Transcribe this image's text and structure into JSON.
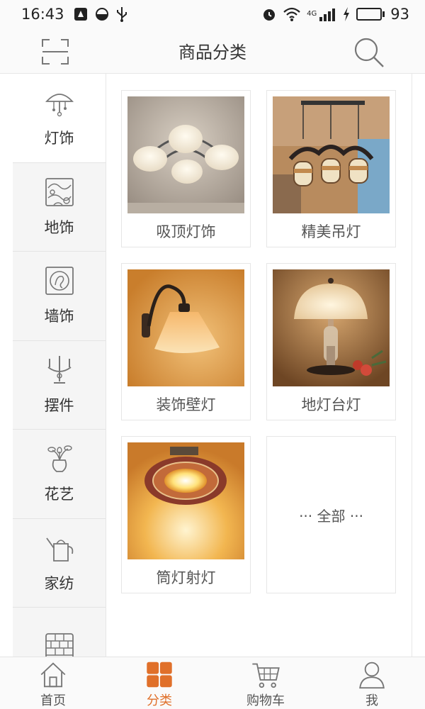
{
  "status_bar": {
    "time": "16:43",
    "battery": "93",
    "battery_level": 0.93,
    "network_label": "4G"
  },
  "header": {
    "title": "商品分类"
  },
  "sidebar": {
    "items": [
      {
        "label": "灯饰",
        "icon": "lamp-icon",
        "active": true
      },
      {
        "label": "地饰",
        "icon": "floor-tile-icon"
      },
      {
        "label": "墙饰",
        "icon": "wall-frame-icon"
      },
      {
        "label": "摆件",
        "icon": "candelabra-icon"
      },
      {
        "label": "花艺",
        "icon": "flower-vase-icon"
      },
      {
        "label": "家纺",
        "icon": "watering-can-icon"
      },
      {
        "label": "",
        "icon": "brick-wall-icon"
      }
    ]
  },
  "grid": {
    "items": [
      {
        "label": "吸顶灯饰",
        "image": "ceiling-lamp-photo"
      },
      {
        "label": "精美吊灯",
        "image": "pendant-lamp-photo"
      },
      {
        "label": "装饰壁灯",
        "image": "wall-lamp-photo"
      },
      {
        "label": "地灯台灯",
        "image": "table-lamp-photo"
      },
      {
        "label": "筒灯射灯",
        "image": "downlight-photo"
      }
    ],
    "all_label": "··· 全部 ···"
  },
  "tabbar": {
    "tabs": [
      {
        "label": "首页",
        "icon": "home-icon"
      },
      {
        "label": "分类",
        "icon": "category-icon",
        "active": true
      },
      {
        "label": "购物车",
        "icon": "cart-icon"
      },
      {
        "label": "我",
        "icon": "user-icon"
      }
    ]
  },
  "colors": {
    "accent": "#e0702a",
    "battery": "#2fc32f",
    "sidebar_bg": "#f5f5f5",
    "border": "#e6e6e6"
  }
}
